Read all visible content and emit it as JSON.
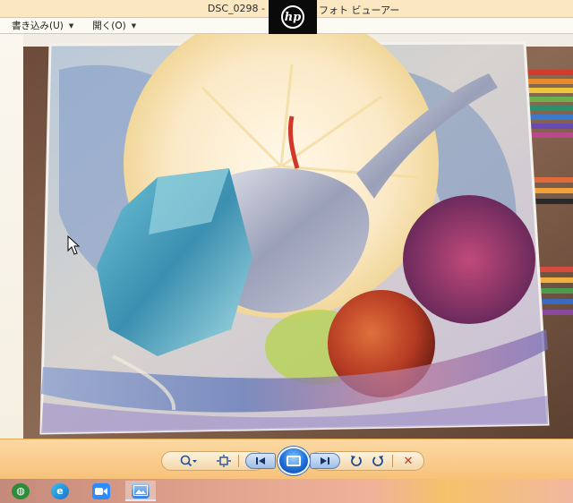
{
  "window": {
    "title_left": "DSC_0298 -",
    "title_right": "フォト ビューアー",
    "overlay_logo": "hp"
  },
  "menu": {
    "items": [
      {
        "label": "書き込み(U)",
        "icon": "chevron-down-icon"
      },
      {
        "label": "開く(O)",
        "icon": "chevron-down-icon"
      }
    ]
  },
  "toolbar": {
    "zoom_icon": "magnifier-icon",
    "fit_icon": "actual-size-icon",
    "prev_icon": "skip-previous-icon",
    "slideshow_icon": "slideshow-icon",
    "next_icon": "skip-next-icon",
    "rotate_ccw_icon": "rotate-counterclockwise-icon",
    "rotate_cw_icon": "rotate-clockwise-icon",
    "delete_icon": "delete-x-icon"
  },
  "taskbar": {
    "apps": [
      {
        "name": "globe-app-icon",
        "color": "#2e8b3a"
      },
      {
        "name": "edge-icon",
        "color": "#1a8fd6"
      },
      {
        "name": "zoom-icon",
        "color": "#2d8cff"
      },
      {
        "name": "photo-viewer-icon",
        "color": "#3b7dd8",
        "active": true
      }
    ]
  },
  "colors": {
    "title_bg": "#fbe7c2",
    "toolbar_bg": "#f7c27a",
    "accent_blue": "#1e6ed6",
    "delete_red": "#c0352b"
  }
}
